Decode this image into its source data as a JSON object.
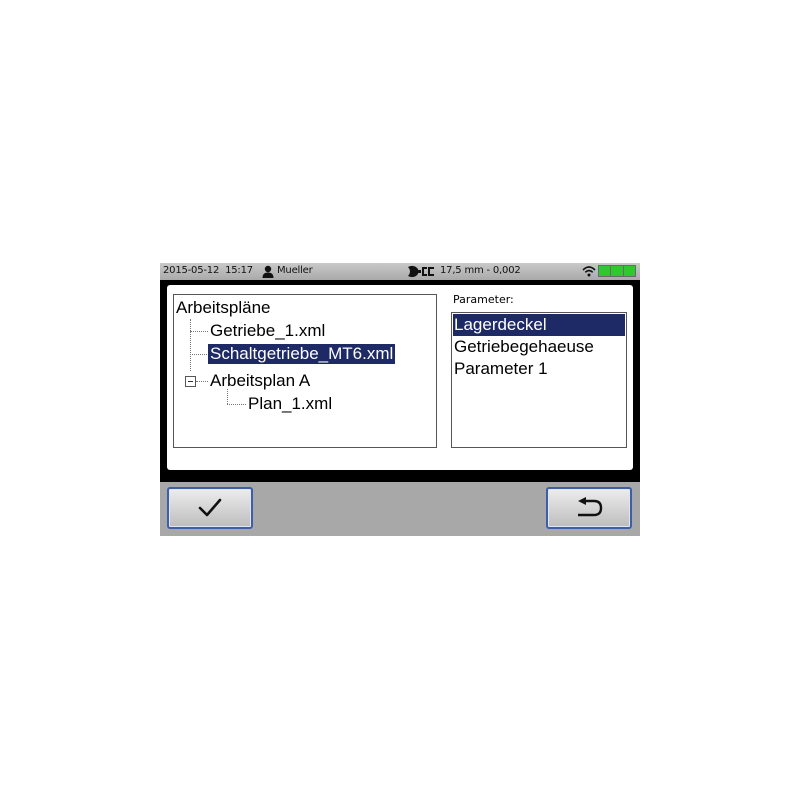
{
  "status_bar": {
    "date": "2015-05-12",
    "time": "15:17",
    "user_name": "Mueller",
    "measurement": "17,5 mm - 0,002",
    "battery_cells": 3,
    "battery_color": "#2fc92f"
  },
  "tree": {
    "root": "Arbeitspläne",
    "nodes": [
      "Getriebe_1.xml",
      "Schaltgetriebe_MT6.xml",
      "Arbeitsplan A",
      "Plan_1.xml"
    ],
    "selected": "Schaltgetriebe_MT6.xml"
  },
  "parameters": {
    "label": "Parameter:",
    "items": [
      "Lagerdeckel",
      "Getriebegehaeuse",
      "Parameter 1"
    ],
    "selected": "Lagerdeckel"
  },
  "buttons": {
    "ok_icon": "checkmark-icon",
    "back_icon": "return-arrow-icon"
  },
  "colors": {
    "selection": "#1e2a66",
    "button_border": "#3c5fa8",
    "status_bar": "#b9b9b9"
  }
}
